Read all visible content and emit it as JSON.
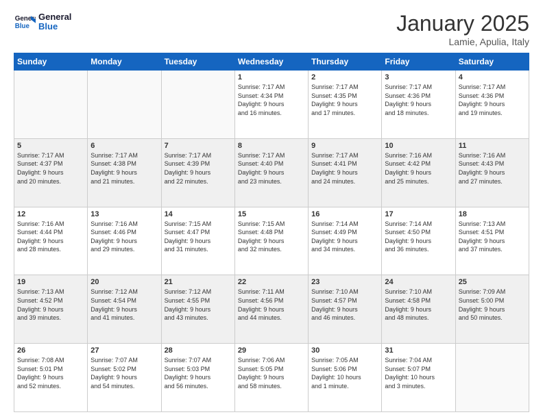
{
  "header": {
    "logo_line1": "General",
    "logo_line2": "Blue",
    "month": "January 2025",
    "location": "Lamie, Apulia, Italy"
  },
  "weekdays": [
    "Sunday",
    "Monday",
    "Tuesday",
    "Wednesday",
    "Thursday",
    "Friday",
    "Saturday"
  ],
  "weeks": [
    [
      {
        "day": "",
        "info": ""
      },
      {
        "day": "",
        "info": ""
      },
      {
        "day": "",
        "info": ""
      },
      {
        "day": "1",
        "info": "Sunrise: 7:17 AM\nSunset: 4:34 PM\nDaylight: 9 hours\nand 16 minutes."
      },
      {
        "day": "2",
        "info": "Sunrise: 7:17 AM\nSunset: 4:35 PM\nDaylight: 9 hours\nand 17 minutes."
      },
      {
        "day": "3",
        "info": "Sunrise: 7:17 AM\nSunset: 4:36 PM\nDaylight: 9 hours\nand 18 minutes."
      },
      {
        "day": "4",
        "info": "Sunrise: 7:17 AM\nSunset: 4:36 PM\nDaylight: 9 hours\nand 19 minutes."
      }
    ],
    [
      {
        "day": "5",
        "info": "Sunrise: 7:17 AM\nSunset: 4:37 PM\nDaylight: 9 hours\nand 20 minutes."
      },
      {
        "day": "6",
        "info": "Sunrise: 7:17 AM\nSunset: 4:38 PM\nDaylight: 9 hours\nand 21 minutes."
      },
      {
        "day": "7",
        "info": "Sunrise: 7:17 AM\nSunset: 4:39 PM\nDaylight: 9 hours\nand 22 minutes."
      },
      {
        "day": "8",
        "info": "Sunrise: 7:17 AM\nSunset: 4:40 PM\nDaylight: 9 hours\nand 23 minutes."
      },
      {
        "day": "9",
        "info": "Sunrise: 7:17 AM\nSunset: 4:41 PM\nDaylight: 9 hours\nand 24 minutes."
      },
      {
        "day": "10",
        "info": "Sunrise: 7:16 AM\nSunset: 4:42 PM\nDaylight: 9 hours\nand 25 minutes."
      },
      {
        "day": "11",
        "info": "Sunrise: 7:16 AM\nSunset: 4:43 PM\nDaylight: 9 hours\nand 27 minutes."
      }
    ],
    [
      {
        "day": "12",
        "info": "Sunrise: 7:16 AM\nSunset: 4:44 PM\nDaylight: 9 hours\nand 28 minutes."
      },
      {
        "day": "13",
        "info": "Sunrise: 7:16 AM\nSunset: 4:46 PM\nDaylight: 9 hours\nand 29 minutes."
      },
      {
        "day": "14",
        "info": "Sunrise: 7:15 AM\nSunset: 4:47 PM\nDaylight: 9 hours\nand 31 minutes."
      },
      {
        "day": "15",
        "info": "Sunrise: 7:15 AM\nSunset: 4:48 PM\nDaylight: 9 hours\nand 32 minutes."
      },
      {
        "day": "16",
        "info": "Sunrise: 7:14 AM\nSunset: 4:49 PM\nDaylight: 9 hours\nand 34 minutes."
      },
      {
        "day": "17",
        "info": "Sunrise: 7:14 AM\nSunset: 4:50 PM\nDaylight: 9 hours\nand 36 minutes."
      },
      {
        "day": "18",
        "info": "Sunrise: 7:13 AM\nSunset: 4:51 PM\nDaylight: 9 hours\nand 37 minutes."
      }
    ],
    [
      {
        "day": "19",
        "info": "Sunrise: 7:13 AM\nSunset: 4:52 PM\nDaylight: 9 hours\nand 39 minutes."
      },
      {
        "day": "20",
        "info": "Sunrise: 7:12 AM\nSunset: 4:54 PM\nDaylight: 9 hours\nand 41 minutes."
      },
      {
        "day": "21",
        "info": "Sunrise: 7:12 AM\nSunset: 4:55 PM\nDaylight: 9 hours\nand 43 minutes."
      },
      {
        "day": "22",
        "info": "Sunrise: 7:11 AM\nSunset: 4:56 PM\nDaylight: 9 hours\nand 44 minutes."
      },
      {
        "day": "23",
        "info": "Sunrise: 7:10 AM\nSunset: 4:57 PM\nDaylight: 9 hours\nand 46 minutes."
      },
      {
        "day": "24",
        "info": "Sunrise: 7:10 AM\nSunset: 4:58 PM\nDaylight: 9 hours\nand 48 minutes."
      },
      {
        "day": "25",
        "info": "Sunrise: 7:09 AM\nSunset: 5:00 PM\nDaylight: 9 hours\nand 50 minutes."
      }
    ],
    [
      {
        "day": "26",
        "info": "Sunrise: 7:08 AM\nSunset: 5:01 PM\nDaylight: 9 hours\nand 52 minutes."
      },
      {
        "day": "27",
        "info": "Sunrise: 7:07 AM\nSunset: 5:02 PM\nDaylight: 9 hours\nand 54 minutes."
      },
      {
        "day": "28",
        "info": "Sunrise: 7:07 AM\nSunset: 5:03 PM\nDaylight: 9 hours\nand 56 minutes."
      },
      {
        "day": "29",
        "info": "Sunrise: 7:06 AM\nSunset: 5:05 PM\nDaylight: 9 hours\nand 58 minutes."
      },
      {
        "day": "30",
        "info": "Sunrise: 7:05 AM\nSunset: 5:06 PM\nDaylight: 10 hours\nand 1 minute."
      },
      {
        "day": "31",
        "info": "Sunrise: 7:04 AM\nSunset: 5:07 PM\nDaylight: 10 hours\nand 3 minutes."
      },
      {
        "day": "",
        "info": ""
      }
    ]
  ]
}
